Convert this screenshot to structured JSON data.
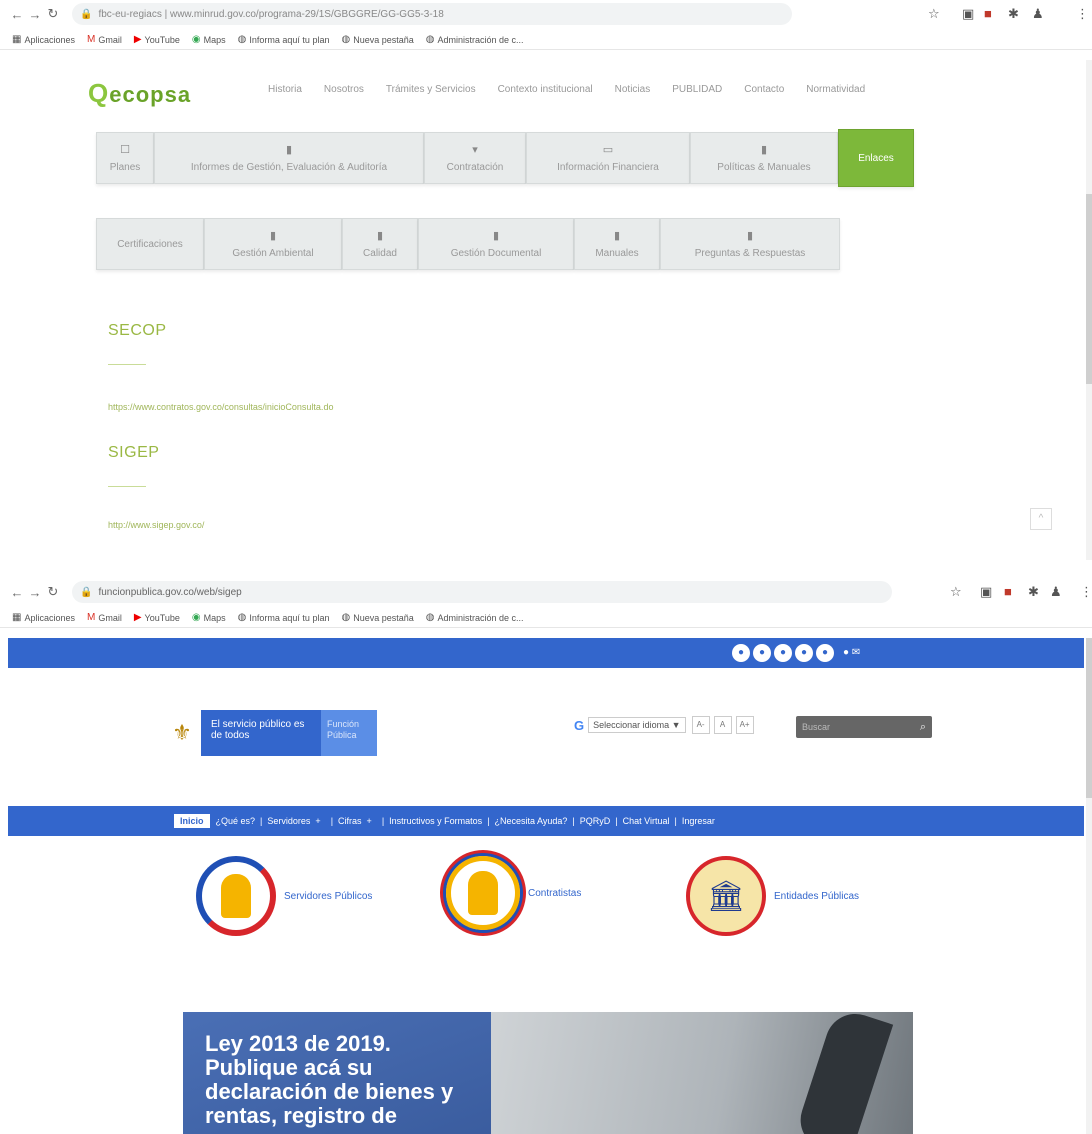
{
  "shot1": {
    "url": "fbc-eu-regiacs | www.minrud.gov.co/programa-29/1S/GBGGRE/GG-GG5-3-18",
    "bookmarks": [
      "Aplicaciones",
      "Gmail",
      "YouTube",
      "Maps",
      "Informa aquí tu plan",
      "Nueva pestaña",
      "Administración de c..."
    ],
    "logo": "ecopsa",
    "topnav": [
      "Historia",
      "Nosotros",
      "Trámites y Servicios",
      "Contexto institucional",
      "Noticias",
      "PUBLIDAD",
      "Contacto",
      "Normatividad"
    ],
    "tabs_row1": [
      {
        "label": "Planes",
        "icon": "☐"
      },
      {
        "label": "Informes de Gestión, Evaluación & Auditoría",
        "icon": "▮"
      },
      {
        "label": "Contratación",
        "icon": "▾"
      },
      {
        "label": "Información Financiera",
        "icon": "▭"
      },
      {
        "label": "Políticas & Manuales",
        "icon": "▮"
      },
      {
        "label": "Enlaces"
      }
    ],
    "tabs_row2": [
      {
        "label": "Certificaciones"
      },
      {
        "label": "Gestión Ambiental",
        "icon": "▮"
      },
      {
        "label": "Calidad",
        "icon": "▮"
      },
      {
        "label": "Gestión Documental",
        "icon": "▮"
      },
      {
        "label": "Manuales",
        "icon": "▮"
      },
      {
        "label": "Preguntas & Respuestas",
        "icon": "▮"
      }
    ],
    "sections": [
      {
        "title": "SECOP",
        "link": "https://www.contratos.gov.co/consultas/inicioConsulta.do"
      },
      {
        "title": "SIGEP",
        "link": "http://www.sigep.gov.co/"
      }
    ],
    "scroll_top": "^"
  },
  "shot2": {
    "url": "funcionpublica.gov.co/web/sigep",
    "bookmarks": [
      "Aplicaciones",
      "Gmail",
      "YouTube",
      "Maps",
      "Informa aquí tu plan",
      "Nueva pestaña",
      "Administración de c..."
    ],
    "social": [
      "●",
      "●",
      "●",
      "●",
      "●"
    ],
    "social_extra": "● ✉",
    "gov_main": "El servicio público es de todos",
    "gov_side": "Función Pública",
    "google_label": "Seleccionar idioma ▼",
    "a_buttons": [
      "A-",
      "A",
      "A+"
    ],
    "search_placeholder": "Buscar",
    "mainnav": [
      "Inicio",
      "¿Qué es?",
      "Servidores",
      "Cifras",
      "Instructivos y Formatos",
      "¿Necesita Ayuda?",
      "PQRyD",
      "Chat Virtual",
      "Ingresar"
    ],
    "roles": [
      "Servidores Públicos",
      "Contratistas",
      "Entidades Públicas"
    ],
    "hero_text": "Ley 2013 de 2019. Publique acá su declaración de bienes y rentas, registro de"
  }
}
